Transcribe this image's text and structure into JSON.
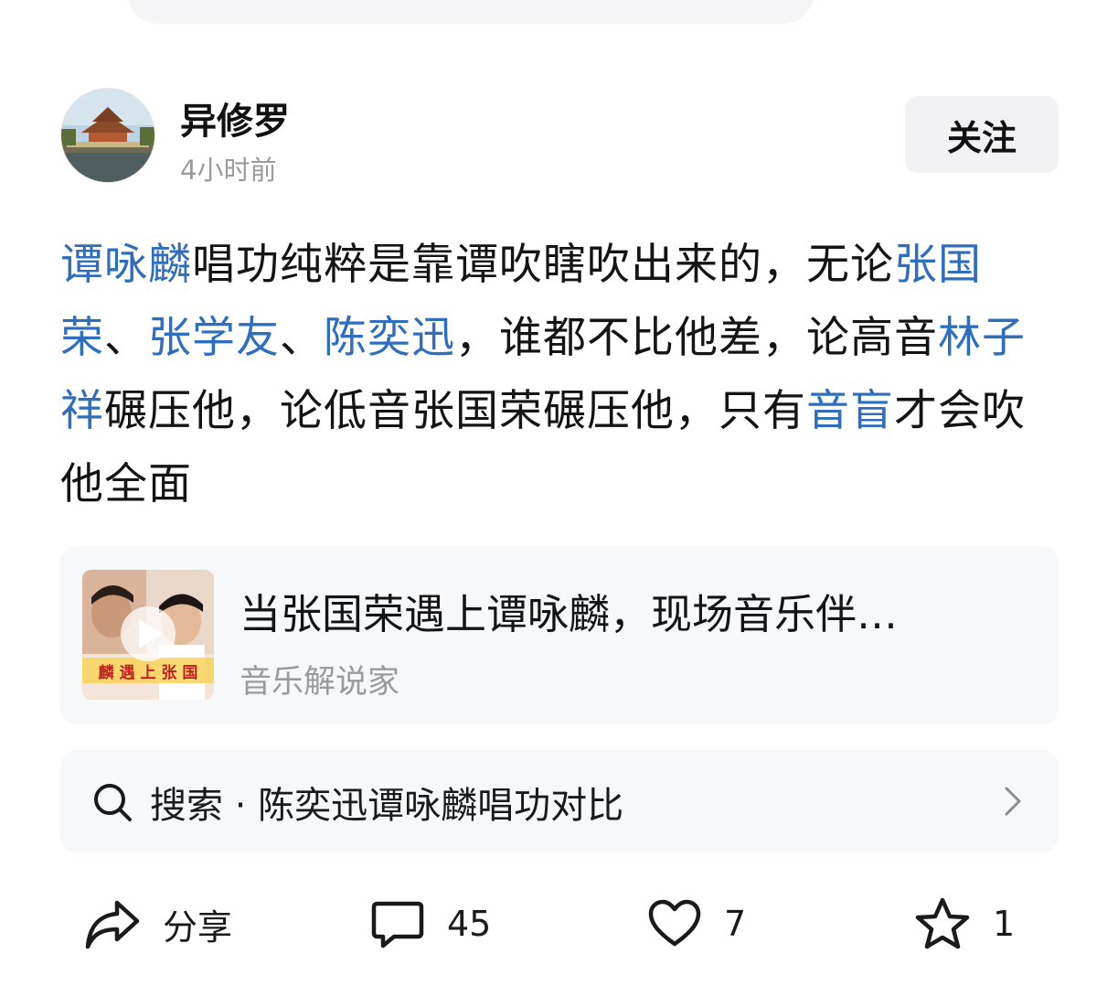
{
  "author": {
    "name": "异修罗",
    "time": "4小时前",
    "follow_label": "关注"
  },
  "post": {
    "segments": [
      {
        "text": "谭咏麟",
        "link": true
      },
      {
        "text": "唱功纯粹是靠谭吹瞎吹出来的，无论",
        "link": false
      },
      {
        "text": "张国荣",
        "link": true
      },
      {
        "text": "、",
        "link": false
      },
      {
        "text": "张学友",
        "link": true
      },
      {
        "text": "、",
        "link": false
      },
      {
        "text": "陈奕迅",
        "link": true
      },
      {
        "text": "，谁都不比他差，论高音",
        "link": false
      },
      {
        "text": "林子祥",
        "link": true
      },
      {
        "text": "碾压他，论低音张国荣碾压他，只有",
        "link": false
      },
      {
        "text": "音盲",
        "link": true
      },
      {
        "text": "才会吹他全面",
        "link": false
      }
    ],
    "link_color": "#2f6dbd"
  },
  "video_card": {
    "title": "当张国荣遇上谭咏麟，现场音乐伴…",
    "source": "音乐解说家",
    "thumb_caption": "麟 遇 上 张 国"
  },
  "search": {
    "icon": "search-icon",
    "text": "搜索 · 陈奕迅谭咏麟唱功对比"
  },
  "actions": {
    "share": {
      "icon": "share-icon",
      "label": "分享"
    },
    "comment": {
      "icon": "comment-icon",
      "count": "45"
    },
    "like": {
      "icon": "heart-icon",
      "count": "7"
    },
    "favorite": {
      "icon": "star-icon",
      "count": "1"
    }
  }
}
